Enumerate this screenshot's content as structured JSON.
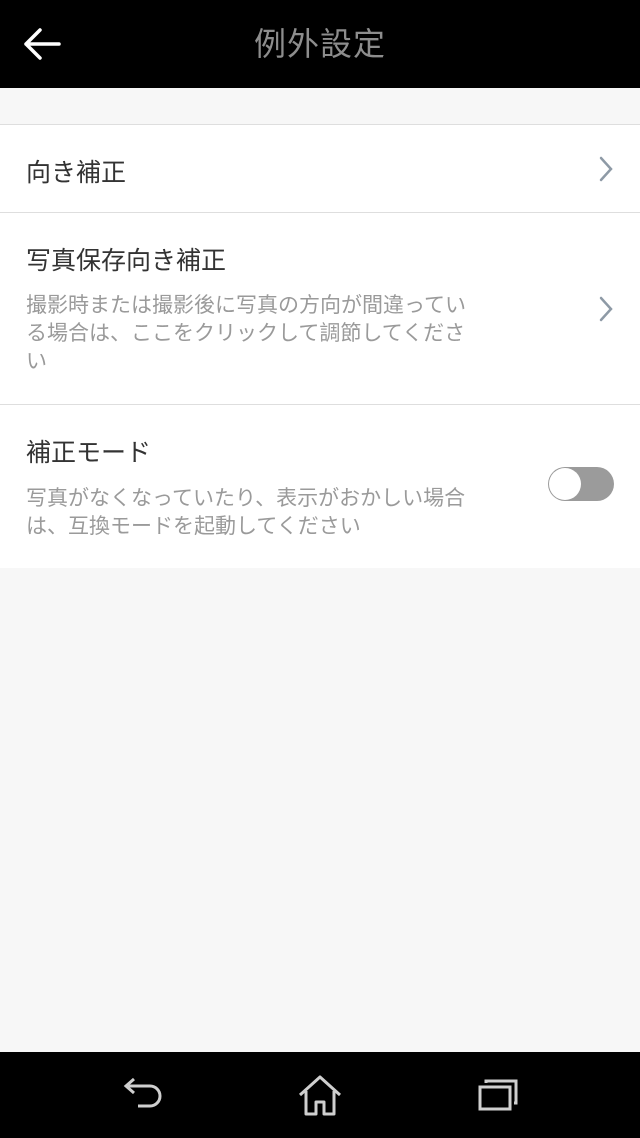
{
  "header": {
    "title": "例外設定",
    "back_icon": "arrow-left-icon"
  },
  "rows": [
    {
      "title": "向き補正",
      "description": "",
      "control": "chevron-right-icon"
    },
    {
      "title": "写真保存向き補正",
      "description": "撮影時または撮影後に写真の方向が間違っている場合は、ここをクリックして調節してください",
      "control": "chevron-right-icon"
    },
    {
      "title": "補正モード",
      "description": "写真がなくなっていたり、表示がおかしい場合は、互換モードを起動してください",
      "control": "toggle",
      "toggle_on": false
    }
  ],
  "navbar": {
    "back_icon": "nav-back-icon",
    "home_icon": "home-icon",
    "recents_icon": "recent-apps-icon"
  },
  "colors": {
    "header_bg": "#000000",
    "title": "#8d8d8d",
    "toggle_off": "#9b9b9b"
  }
}
